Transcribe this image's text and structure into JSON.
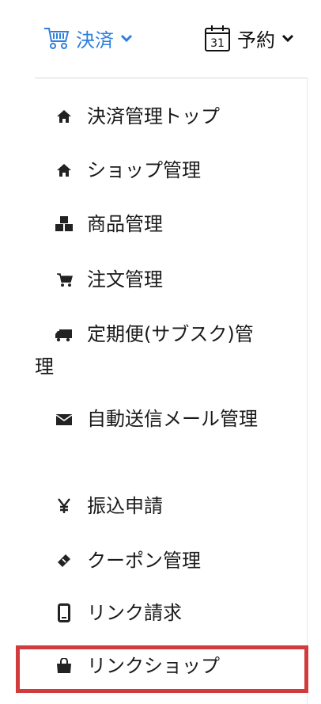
{
  "nav": {
    "payment_label": "決済",
    "reserve_label": "予約",
    "calendar_day": "31"
  },
  "menu": {
    "items": [
      {
        "label": "決済管理トップ",
        "icon": "home-icon"
      },
      {
        "label": "ショップ管理",
        "icon": "home-icon"
      },
      {
        "label": "商品管理",
        "icon": "cubes-icon"
      },
      {
        "label": "注文管理",
        "icon": "cart-icon"
      },
      {
        "label": "定期便(サブスク)管理",
        "icon": "truck-icon"
      },
      {
        "label": "自動送信メール管理",
        "icon": "envelope-icon"
      },
      {
        "label": "振込申請",
        "icon": "yen-icon"
      },
      {
        "label": "クーポン管理",
        "icon": "ticket-icon"
      },
      {
        "label": "リンク請求",
        "icon": "mobile-icon"
      },
      {
        "label": "リンクショップ",
        "icon": "shopping-bag-icon"
      }
    ]
  },
  "colors": {
    "accent": "#2d7fe0",
    "highlight": "#d23b3b"
  }
}
